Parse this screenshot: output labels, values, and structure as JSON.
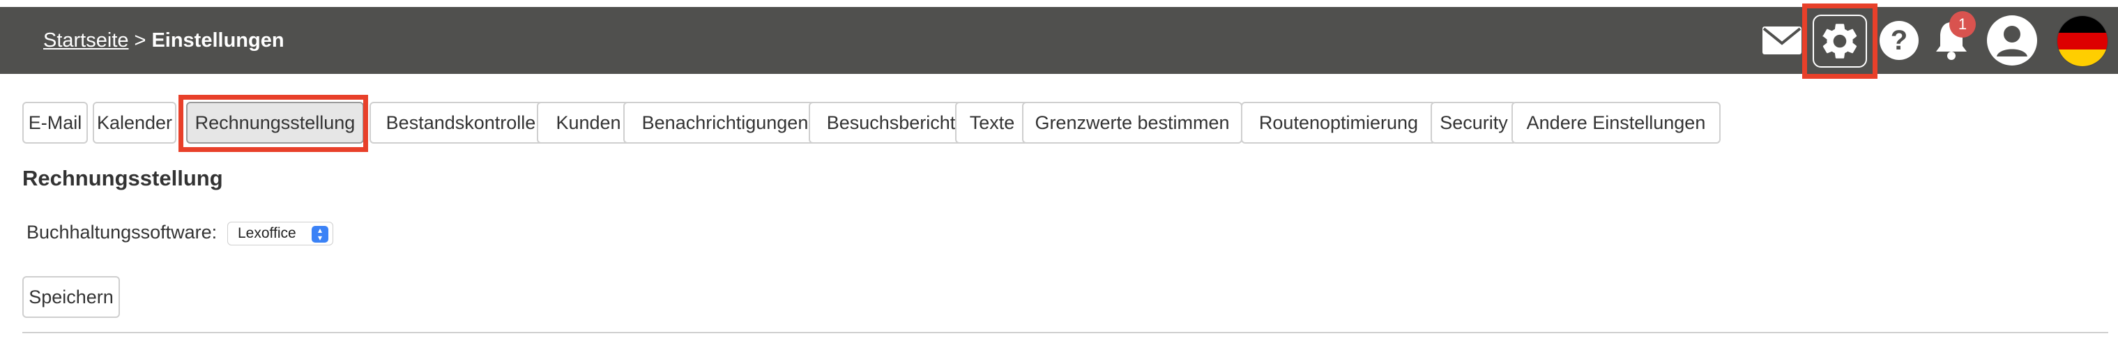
{
  "header": {
    "breadcrumb_home": "Startseite",
    "breadcrumb_sep": ">",
    "breadcrumb_current": "Einstellungen",
    "notification_count": "1",
    "icons": [
      "mail-icon",
      "gear-icon",
      "help-icon",
      "bell-icon",
      "user-icon",
      "flag-de-icon"
    ]
  },
  "tabs": [
    {
      "label": "E-Mail"
    },
    {
      "label": "Kalender"
    },
    {
      "label": "Rechnungsstellung"
    },
    {
      "label": "Bestandskontrolle"
    },
    {
      "label": "Kunden"
    },
    {
      "label": "Benachrichtigungen"
    },
    {
      "label": "Besuchsbericht"
    },
    {
      "label": "Texte"
    },
    {
      "label": "Grenzwerte bestimmen"
    },
    {
      "label": "Routenoptimierung"
    },
    {
      "label": "Security"
    },
    {
      "label": "Andere Einstellungen"
    }
  ],
  "main": {
    "title": "Rechnungsstellung",
    "software_label": "Buchhaltungssoftware:",
    "software_value": "Lexoffice",
    "save_label": "Speichern"
  },
  "colors": {
    "topbar": "#50504e",
    "highlight": "#e8402a",
    "badge": "#d9534f",
    "select_arrows": "#3b82f6"
  }
}
